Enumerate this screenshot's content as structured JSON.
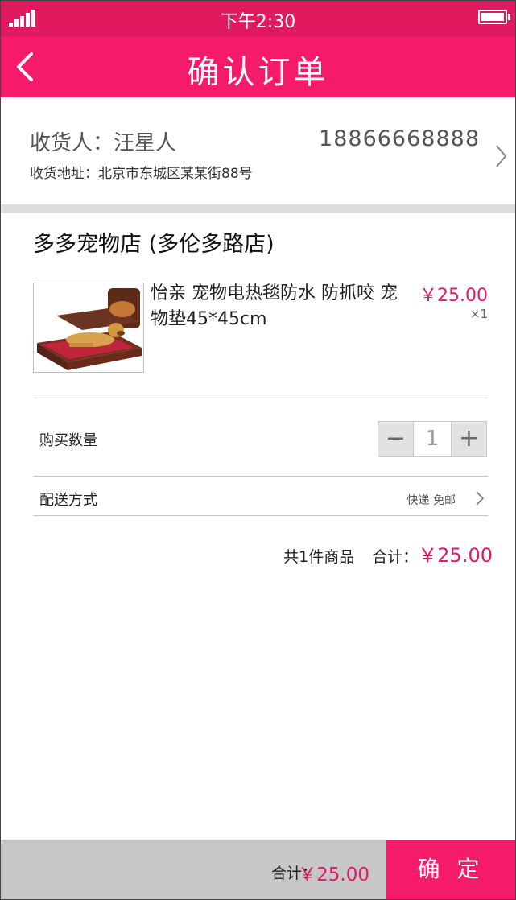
{
  "status_bar": {
    "time": "下午2:30"
  },
  "nav": {
    "title": "确认订单"
  },
  "address": {
    "receiver": "收货人：汪星人",
    "phone": "18866668888",
    "address": "收货地址：北京市东城区某某街88号"
  },
  "shop": {
    "name": "多多宠物店 (多伦多路店)"
  },
  "product": {
    "name": "怡亲 宠物电热毯防水 防抓咬 宠物垫45*45cm",
    "price": "￥25.00",
    "quantity": "×1"
  },
  "quantity_row": {
    "label": "购买数量",
    "minus": "−",
    "value": "1",
    "plus": "+"
  },
  "shipping": {
    "label": "配送方式",
    "value": "快递 免邮"
  },
  "summary": {
    "count_text": "共1件商品",
    "total_label": "合计：",
    "total_price": "￥25.00"
  },
  "bottom_bar": {
    "total_label": "合计：",
    "total_price": "￥25.00",
    "confirm_label": "确 定"
  },
  "colors": {
    "accent": "#f51a6a",
    "status_bar": "#e11a5f",
    "price": "#e5186b"
  },
  "icons": {
    "back": "chevron-left-icon",
    "arrow": "chevron-right-icon",
    "signal": "signal-icon",
    "battery": "battery-icon"
  }
}
